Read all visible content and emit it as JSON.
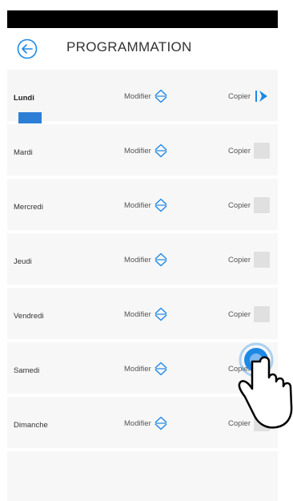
{
  "header": {
    "title": "PROGRAMMATION"
  },
  "days": [
    {
      "name": "Lundi",
      "modify_label": "Modifier",
      "copy_label": "Copier",
      "selected": true
    },
    {
      "name": "Mardi",
      "modify_label": "Modifier",
      "copy_label": "Copier"
    },
    {
      "name": "Mercredi",
      "modify_label": "Modifier",
      "copy_label": "Copier"
    },
    {
      "name": "Jeudi",
      "modify_label": "Modifier",
      "copy_label": "Copier"
    },
    {
      "name": "Vendredi",
      "modify_label": "Modifier",
      "copy_label": "Copier"
    },
    {
      "name": "Samedi",
      "modify_label": "Modifier",
      "copy_label": "Copier"
    },
    {
      "name": "Dimanche",
      "modify_label": "Modifier",
      "copy_label": "Copier"
    }
  ],
  "colors": {
    "accent": "#1e88e5",
    "marker": "#2d7fd6"
  }
}
